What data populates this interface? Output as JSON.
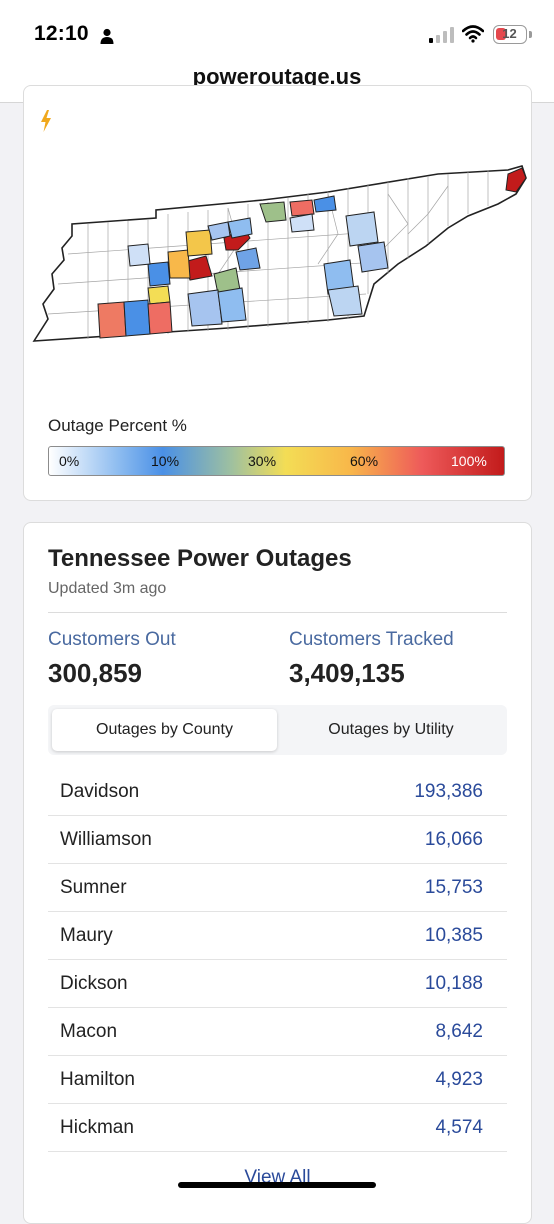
{
  "status_bar": {
    "time": "12:10",
    "battery": "12"
  },
  "browser": {
    "url": "poweroutage.us"
  },
  "map_card": {
    "legend_title": "Outage Percent %",
    "legend_stops": [
      "0%",
      "10%",
      "30%",
      "60%",
      "100%"
    ]
  },
  "outages": {
    "title": "Tennessee Power Outages",
    "updated": "Updated 3m ago",
    "customers_out_label": "Customers Out",
    "customers_out_value": "300,859",
    "customers_tracked_label": "Customers Tracked",
    "customers_tracked_value": "3,409,135",
    "tabs": [
      "Outages by County",
      "Outages by Utility"
    ],
    "active_tab": "Outages by County",
    "rows": [
      {
        "county": "Davidson",
        "count": "193,386"
      },
      {
        "county": "Williamson",
        "count": "16,066"
      },
      {
        "county": "Sumner",
        "count": "15,753"
      },
      {
        "county": "Maury",
        "count": "10,385"
      },
      {
        "county": "Dickson",
        "count": "10,188"
      },
      {
        "county": "Macon",
        "count": "8,642"
      },
      {
        "county": "Hamilton",
        "count": "4,923"
      },
      {
        "county": "Hickman",
        "count": "4,574"
      }
    ],
    "view_all": "View All"
  }
}
